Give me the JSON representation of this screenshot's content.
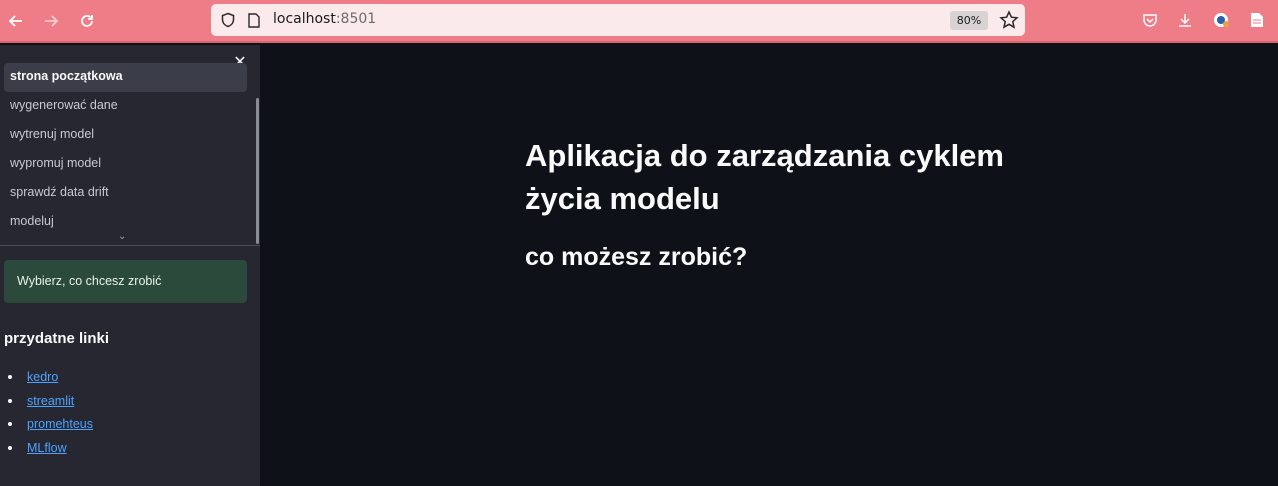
{
  "browser": {
    "url_host": "localhost",
    "url_port": ":8501",
    "zoom": "80%",
    "icons": [
      "back-arrow-icon",
      "forward-arrow-icon",
      "reload-icon",
      "shield-icon",
      "page-icon",
      "star-icon",
      "pocket-icon",
      "download-icon",
      "extension-icon",
      "document-icon"
    ]
  },
  "sidebar": {
    "nav_items": [
      {
        "label": "strona początkowa",
        "active": true
      },
      {
        "label": "wygenerować dane"
      },
      {
        "label": "wytrenuj model"
      },
      {
        "label": "wypromuj model"
      },
      {
        "label": "sprawdź data drift"
      },
      {
        "label": "modeluj"
      }
    ],
    "info": "Wybierz, co chcesz zrobić",
    "links_heading": "przydatne linki",
    "links": [
      "kedro",
      "streamlit",
      "promehteus",
      "MLflow"
    ]
  },
  "main": {
    "title": "Aplikacja do zarządzania cyklem życia modelu",
    "subtitle": "co możesz zrobić?"
  },
  "colors": {
    "chrome": "#ef7d87",
    "sidebar_bg": "#262730",
    "main_bg": "#0e1117",
    "info_bg": "#2b4a3b",
    "link": "#4da3ff"
  }
}
